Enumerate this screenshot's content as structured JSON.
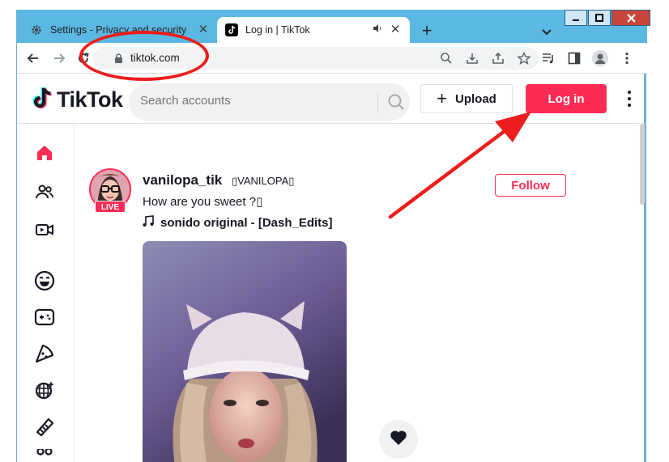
{
  "browser": {
    "tabs": [
      {
        "title": "Settings - Privacy and security",
        "icon": "gear-icon",
        "active": false
      },
      {
        "title": "Log in | TikTok",
        "icon": "tiktok-favicon",
        "active": true,
        "audio": true
      }
    ],
    "new_tab_label": "+",
    "window_controls": {
      "minimize": "▁",
      "maximize": "□",
      "close": "✕"
    },
    "url": "tiktok.com",
    "colors": {
      "tabstrip": "#5bb8e2",
      "annotation": "#ee1c1c"
    }
  },
  "header": {
    "logo_text": "TikTok",
    "search_placeholder": "Search accounts",
    "upload_label": "Upload",
    "login_label": "Log in",
    "colors": {
      "brand_red": "#fe2c55",
      "cyan": "#25f4ee"
    }
  },
  "sidebar": {
    "items": [
      {
        "icon": "home-icon",
        "active": true
      },
      {
        "icon": "following-icon"
      },
      {
        "icon": "live-icon"
      },
      {
        "icon": "comedy-icon"
      },
      {
        "icon": "gaming-icon"
      },
      {
        "icon": "food-icon"
      },
      {
        "icon": "dance-icon"
      },
      {
        "icon": "beauty-icon"
      }
    ]
  },
  "post": {
    "username": "vanilopa_tik",
    "nickname": "▯VANILOPA▯",
    "live_badge": "LIVE",
    "caption": "How are you sweet ?▯",
    "music": "sonido original - [Dash_Edits]",
    "follow_label": "Follow"
  }
}
